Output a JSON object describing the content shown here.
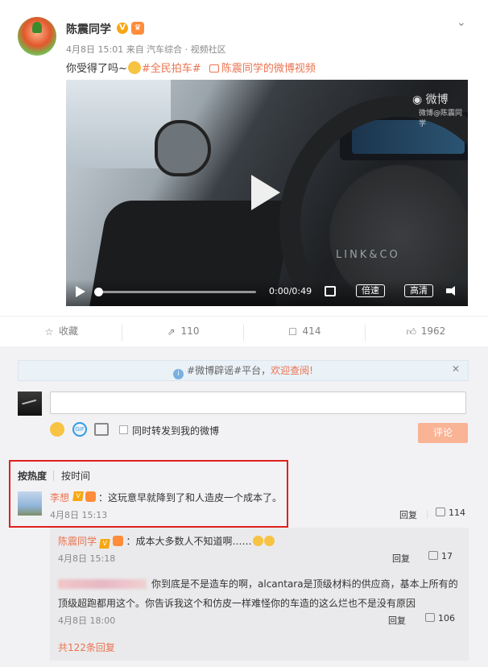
{
  "post": {
    "username": "陈震同学",
    "v_badge": "V",
    "meta": "4月8日 15:01 来自 汽车综合 · 视频社区",
    "text_prefix": "你受得了吗~",
    "hashtag": "#全民拍车#",
    "video_link": "陈震同学的微博视频",
    "expand_icon": "chevron-down-icon"
  },
  "video": {
    "watermark": "微博",
    "watermark_sub": "微博@陈震同学",
    "brand": "LINK&CO",
    "time": "0:00/0:49",
    "speed_label": "倍速",
    "quality_label": "高清",
    "progress": 0.0
  },
  "actions": {
    "favorite": "收藏",
    "repost": "110",
    "comment": "414",
    "like": "1962"
  },
  "notice": {
    "tag": "#微博辟谣#平台",
    "text": "，",
    "link": "欢迎查阅!"
  },
  "composer": {
    "repost_label": "同时转发到我的微博",
    "submit": "评论"
  },
  "sort": {
    "hot": "按热度",
    "time": "按时间"
  },
  "comment": {
    "user": "李想",
    "text": "：这玩意早就降到了和人造皮一个成本了。",
    "date": "4月8日 15:13",
    "reply": "回复",
    "likes": "114"
  },
  "replies": [
    {
      "user": "陈震同学",
      "text": "：成本大多数人不知道啊……",
      "date": "4月8日 15:18",
      "reply": "回复",
      "likes": "17"
    },
    {
      "text_line1": "你到底是不是造车的啊，alcantara是顶级材料的供应商，基本上所有的",
      "text_line2": "顶级超跑都用这个。你告诉我这个和仿皮一样难怪你的车造的这么烂也不是没有原因",
      "date": "4月8日 18:00",
      "reply": "回复",
      "likes": "106"
    }
  ],
  "more_replies": "共122条回复",
  "colors": {
    "accent": "#eb7350",
    "highlight": "#e0201c",
    "submit_disabled": "#f9b395"
  }
}
